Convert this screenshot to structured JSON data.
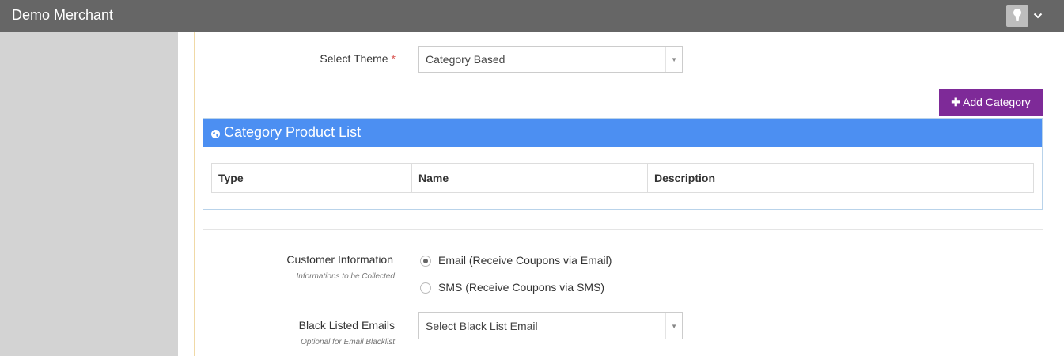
{
  "header": {
    "brand": "Demo Merchant",
    "user_icon": "keyhole-icon",
    "menu_icon": "chevron-down-icon"
  },
  "theme": {
    "label": "Select Theme",
    "required_mark": "*",
    "value": "Category Based"
  },
  "add_category": {
    "icon": "plus-icon",
    "label": "Add Category"
  },
  "category_panel": {
    "title": "Category Product List",
    "icon": "globe-icon",
    "columns": [
      "Type",
      "Name",
      "Description"
    ]
  },
  "customer_info": {
    "label": "Customer Information",
    "hint": "Informations to be Collected",
    "options": [
      {
        "label": "Email (Receive Coupons via Email)",
        "checked": true
      },
      {
        "label": "SMS (Receive Coupons via SMS)",
        "checked": false
      }
    ]
  },
  "blacklist": {
    "label": "Black Listed Emails",
    "hint": "Optional for Email Blacklist",
    "placeholder": "Select Black List Email"
  },
  "colors": {
    "topbar": "#666666",
    "sidebar": "#d3d3d3",
    "panel_header": "#4c8ff2",
    "add_button": "#7e2a98"
  }
}
